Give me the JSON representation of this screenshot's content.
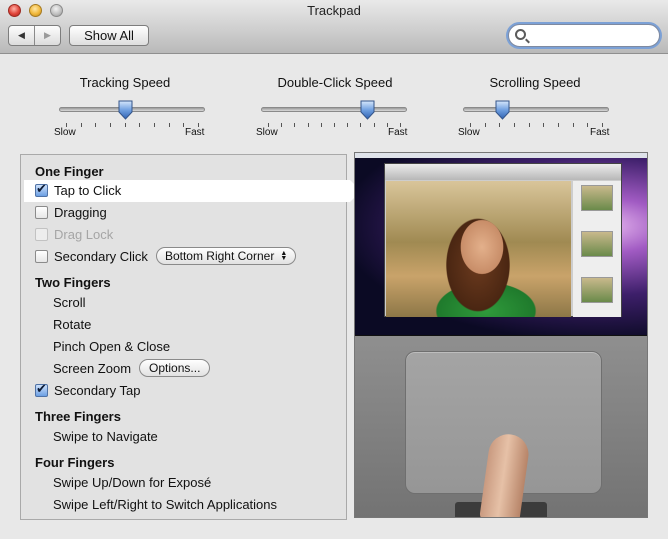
{
  "window": {
    "title": "Trackpad"
  },
  "toolbar": {
    "back_glyph": "◀",
    "forward_glyph": "▶",
    "show_all_label": "Show All",
    "search_placeholder": "",
    "search_value": ""
  },
  "sliders": [
    {
      "label": "Tracking Speed",
      "min_label": "Slow",
      "max_label": "Fast",
      "level": 0.45,
      "ticks": 10
    },
    {
      "label": "Double-Click Speed",
      "min_label": "Slow",
      "max_label": "Fast",
      "level": 0.75,
      "ticks": 11
    },
    {
      "label": "Scrolling Speed",
      "min_label": "Slow",
      "max_label": "Fast",
      "level": 0.24,
      "ticks": 10
    }
  ],
  "sections": {
    "one_finger": {
      "heading": "One Finger",
      "tap_to_click": {
        "label": "Tap to Click",
        "checked": true
      },
      "dragging": {
        "label": "Dragging",
        "checked": false
      },
      "drag_lock": {
        "label": "Drag Lock",
        "checked": false,
        "disabled": true
      },
      "secondary_click": {
        "label": "Secondary Click",
        "checked": false,
        "popup_value": "Bottom Right Corner"
      }
    },
    "two_fingers": {
      "heading": "Two Fingers",
      "scroll": "Scroll",
      "rotate": "Rotate",
      "pinch": "Pinch Open & Close",
      "screen_zoom": {
        "label": "Screen Zoom",
        "button": "Options..."
      },
      "secondary_tap": {
        "label": "Secondary Tap",
        "checked": true
      }
    },
    "three_fingers": {
      "heading": "Three Fingers",
      "swipe_navigate": "Swipe to Navigate"
    },
    "four_fingers": {
      "heading": "Four Fingers",
      "swipe_expose": "Swipe Up/Down for Exposé",
      "swipe_switch": "Swipe Left/Right to Switch Applications"
    }
  },
  "colors": {
    "selection_highlight": "#ffffff",
    "checkbox_checked": "#6c9fe3",
    "search_focus_ring": "#7ca1d6"
  }
}
